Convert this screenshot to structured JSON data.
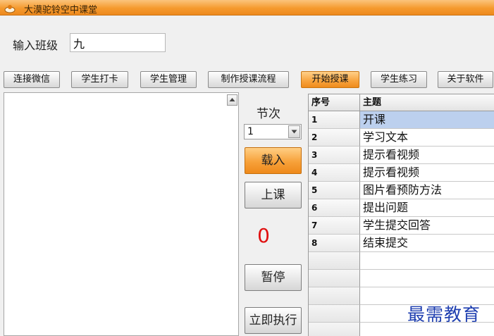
{
  "window": {
    "title": "大漠驼铃空中课堂"
  },
  "class_field": {
    "label": "输入班级",
    "value": "九"
  },
  "toolbar": {
    "buttons": [
      {
        "label": "连接微信",
        "active": false
      },
      {
        "label": "学生打卡",
        "active": false
      },
      {
        "label": "学生管理",
        "active": false
      },
      {
        "label": "制作授课流程",
        "active": false
      },
      {
        "label": "开始授课",
        "active": true
      },
      {
        "label": "学生练习",
        "active": false
      },
      {
        "label": "关于软件",
        "active": false
      }
    ]
  },
  "session": {
    "label": "节次",
    "selected": "1"
  },
  "actions": {
    "load": "载入",
    "start_class": "上课",
    "pause": "暂停",
    "execute_now": "立即执行"
  },
  "counter": "0",
  "steps_table": {
    "columns": [
      "序号",
      "主题"
    ],
    "rows": [
      {
        "no": "1",
        "topic": "开课",
        "selected": true
      },
      {
        "no": "2",
        "topic": "学习文本"
      },
      {
        "no": "3",
        "topic": "提示看视频"
      },
      {
        "no": "4",
        "topic": "提示看视频"
      },
      {
        "no": "5",
        "topic": "图片看预防方法"
      },
      {
        "no": "6",
        "topic": "提出问题"
      },
      {
        "no": "7",
        "topic": "学生提交回答"
      },
      {
        "no": "8",
        "topic": "结束提交"
      }
    ]
  },
  "watermark": "最需教育",
  "colors": {
    "accent_orange": "#f59a2e",
    "selected_row": "#bcd0ee",
    "counter_red": "#e01010",
    "watermark_blue": "#1f3fb0"
  }
}
